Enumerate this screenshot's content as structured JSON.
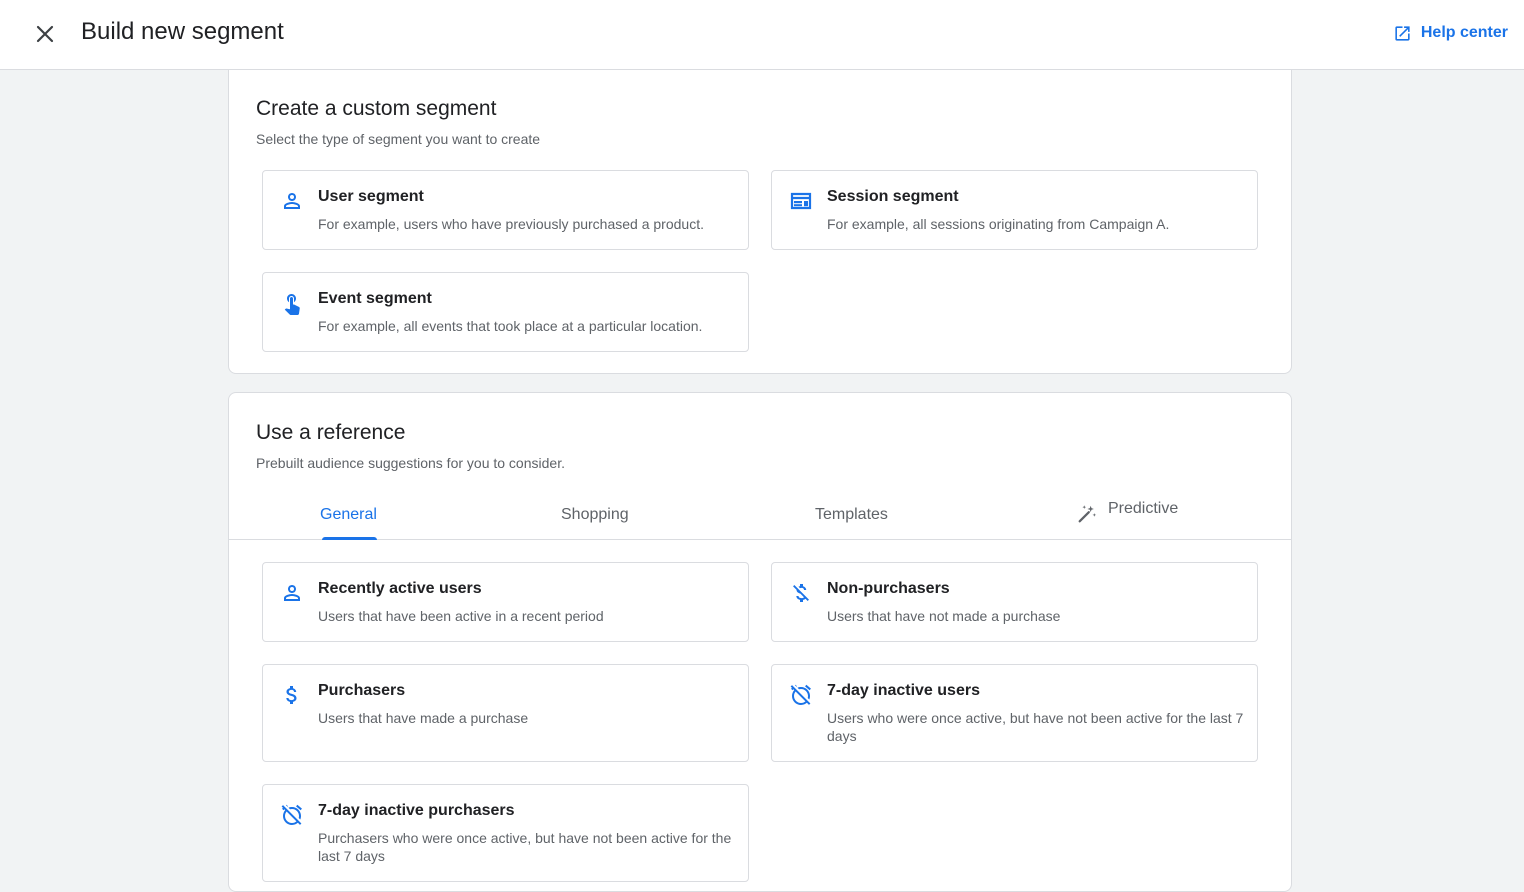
{
  "header": {
    "title": "Build new segment",
    "help_label": "Help center"
  },
  "custom_segment": {
    "title": "Create a custom segment",
    "subtitle": "Select the type of segment you want to create",
    "options": [
      {
        "icon": "person-icon",
        "title": "User segment",
        "description": "For example, users who have previously purchased a product."
      },
      {
        "icon": "session-icon",
        "title": "Session segment",
        "description": "For example, all sessions originating from Campaign A."
      },
      {
        "icon": "touch-icon",
        "title": "Event segment",
        "description": "For example, all events that took place at a particular location."
      }
    ]
  },
  "reference": {
    "title": "Use a reference",
    "subtitle": "Prebuilt audience suggestions for you to consider.",
    "tabs": [
      {
        "label": "General",
        "active": true
      },
      {
        "label": "Shopping",
        "active": false
      },
      {
        "label": "Templates",
        "active": false
      },
      {
        "label": "Predictive",
        "active": false,
        "icon": "magic-wand-icon"
      }
    ],
    "suggestions": [
      {
        "icon": "person-icon",
        "title": "Recently active users",
        "description": "Users that have been active in a recent period"
      },
      {
        "icon": "money-off-icon",
        "title": "Non-purchasers",
        "description": "Users that have not made a purchase"
      },
      {
        "icon": "dollar-icon",
        "title": "Purchasers",
        "description": "Users that have made a purchase"
      },
      {
        "icon": "alarm-off-icon",
        "title": "7-day inactive users",
        "description": "Users who were once active, but have not been active for the last 7 days"
      },
      {
        "icon": "alarm-off-icon",
        "title": "7-day inactive purchasers",
        "description": "Purchasers who were once active, but have not been active for the last 7 days"
      }
    ]
  },
  "colors": {
    "accent": "#1a73e8",
    "text": "#202124",
    "secondary_text": "#5f6368",
    "border": "#dadce0",
    "background": "#f1f3f4"
  }
}
